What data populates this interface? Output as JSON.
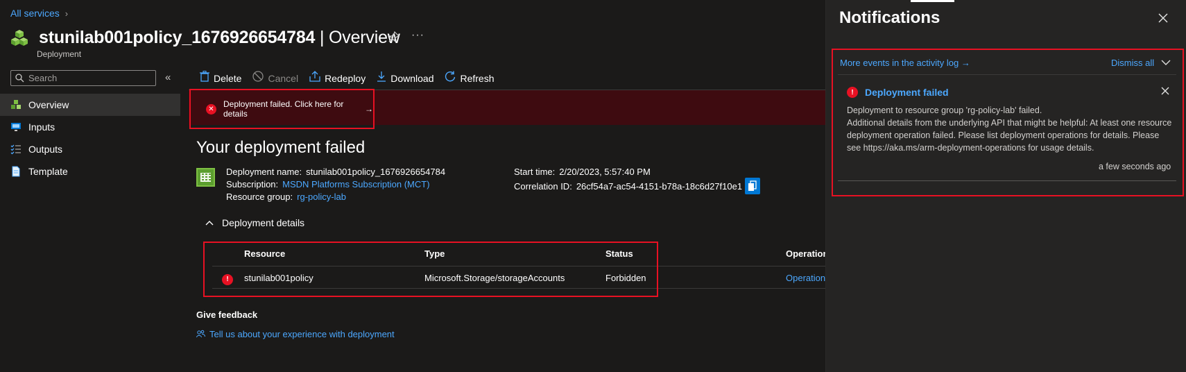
{
  "breadcrumb": {
    "root": "All services",
    "chevron": "›"
  },
  "header": {
    "title_main": "stunilab001policy_1676926654784",
    "title_sep": " | ",
    "title_section": "Overview",
    "subtitle": "Deployment",
    "pin_icon": "pin-icon",
    "more": "···"
  },
  "sidebar": {
    "search_placeholder": "Search",
    "collapse": "«",
    "items": [
      {
        "label": "Overview",
        "icon": "cubes-icon",
        "active": true
      },
      {
        "label": "Inputs",
        "icon": "monitor-icon"
      },
      {
        "label": "Outputs",
        "icon": "checklist-icon"
      },
      {
        "label": "Template",
        "icon": "document-icon"
      }
    ]
  },
  "toolbar": {
    "delete": "Delete",
    "cancel": "Cancel",
    "redeploy": "Redeploy",
    "download": "Download",
    "refresh": "Refresh"
  },
  "banner": {
    "text": "Deployment failed. Click here for details",
    "arrow": "→"
  },
  "main": {
    "heading": "Your deployment failed",
    "deployment_name_label": "Deployment name:",
    "deployment_name": "stunilab001policy_1676926654784",
    "subscription_label": "Subscription:",
    "subscription": "MSDN Platforms Subscription (MCT)",
    "resource_group_label": "Resource group:",
    "resource_group": "rg-policy-lab",
    "start_time_label": "Start time:",
    "start_time": "2/20/2023, 5:57:40 PM",
    "correlation_label": "Correlation ID:",
    "correlation_id": "26cf54a7-ac54-4151-b78a-18c6d27f10e1",
    "details_heading": "Deployment details",
    "table": {
      "headers": [
        "Resource",
        "Type",
        "Status",
        "Operation"
      ],
      "rows": [
        {
          "resource": "stunilab001policy",
          "type": "Microsoft.Storage/storageAccounts",
          "status": "Forbidden",
          "operation": "Operation"
        }
      ]
    },
    "give_feedback": "Give feedback",
    "feedback_link": "Tell us about your experience with deployment"
  },
  "notifications": {
    "title": "Notifications",
    "activity_link": "More events in the activity log →",
    "dismiss_all": "Dismiss all",
    "item": {
      "title": "Deployment failed",
      "line1": "Deployment to resource group 'rg-policy-lab' failed.",
      "line2": "Additional details from the underlying API that might be helpful: At least one resource deployment operation failed. Please list deployment operations for details. Please see https://aka.ms/arm-deployment-operations for usage details.",
      "time": "a few seconds ago"
    }
  },
  "colors": {
    "accent": "#4ca8ff",
    "error": "#e81123",
    "background": "#1b1a19",
    "panel": "#252423"
  }
}
